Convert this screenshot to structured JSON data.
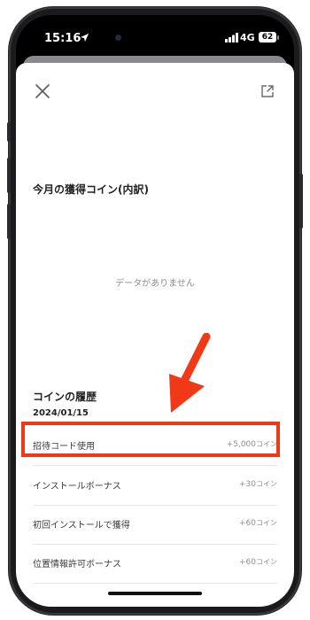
{
  "status_bar": {
    "time": "15:16",
    "network": "4G",
    "battery": "62",
    "location_icon": "location-arrow-icon",
    "signal_icon": "cellular-signal-icon"
  },
  "header": {
    "close_icon": "close-icon",
    "share_icon": "share-external-icon"
  },
  "monthly": {
    "title": "今月の獲得コイン(内訳)",
    "empty_text": "データがありません"
  },
  "history": {
    "title": "コインの履歴",
    "date": "2024/01/15",
    "items": [
      {
        "label": "招待コード使用",
        "amount": "+5,000",
        "unit": "コイン"
      },
      {
        "label": "インストールボーナス",
        "amount": "+30",
        "unit": "コイン"
      },
      {
        "label": "初回インストールで獲得",
        "amount": "+60",
        "unit": "コイン"
      },
      {
        "label": "位置情報許可ボーナス",
        "amount": "+60",
        "unit": "コイン"
      }
    ]
  },
  "annotation": {
    "color": "#f03a17"
  }
}
